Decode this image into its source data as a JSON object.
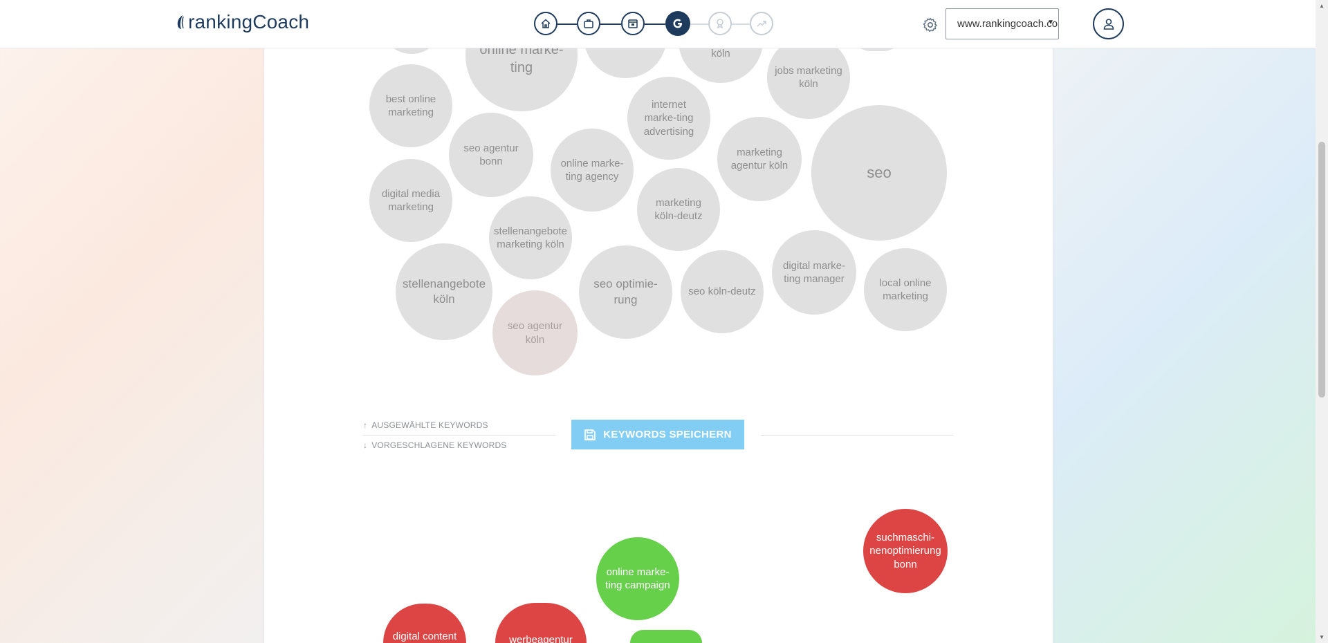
{
  "header": {
    "logo_text": "rankingCoach",
    "domain_value": "www.rankingcoach.com",
    "steps": [
      {
        "icon": "home-icon",
        "state": "done"
      },
      {
        "icon": "briefcase-icon",
        "state": "done"
      },
      {
        "icon": "calendar-icon",
        "state": "done"
      },
      {
        "icon": "google-icon",
        "state": "active",
        "label": "G"
      },
      {
        "icon": "award-icon",
        "state": "todo"
      },
      {
        "icon": "trending-icon",
        "state": "todo"
      }
    ]
  },
  "selected_keywords": [
    "online marke-ting",
    "best online marketing",
    "seo agentur bonn",
    "online marke-ting agency",
    "internet marke-ting advertising",
    "marketing agentur köln",
    "jobs marketing köln",
    "seo",
    "köln",
    "digital media marketing",
    "marketing köln-deutz",
    "stellenangebote marketing köln",
    "stellenangebote köln",
    "seo optimie-rung",
    "seo köln-deutz",
    "digital marke-ting manager",
    "local online marketing",
    "seo agentur köln"
  ],
  "legend": {
    "selected": "AUSGEWÄHLTE KEYWORDS",
    "suggested": "VORGESCHLAGENE KEYWORDS"
  },
  "save_button": {
    "label": "KEYWORDS SPEICHERN",
    "color": "#82cdf4"
  },
  "suggested_keywords": [
    {
      "label": "suchmaschi-nenoptimierung bonn",
      "status": "red"
    },
    {
      "label": "online marke-ting campaign",
      "status": "green"
    },
    {
      "label": "digital content",
      "status": "red"
    },
    {
      "label": "werbeagentur",
      "status": "red"
    },
    {
      "label": "",
      "status": "green"
    }
  ],
  "colors": {
    "brand": "#1e3a5c",
    "red": "#dd4444",
    "green": "#66d04b",
    "bubble": "#e0e0e1"
  }
}
